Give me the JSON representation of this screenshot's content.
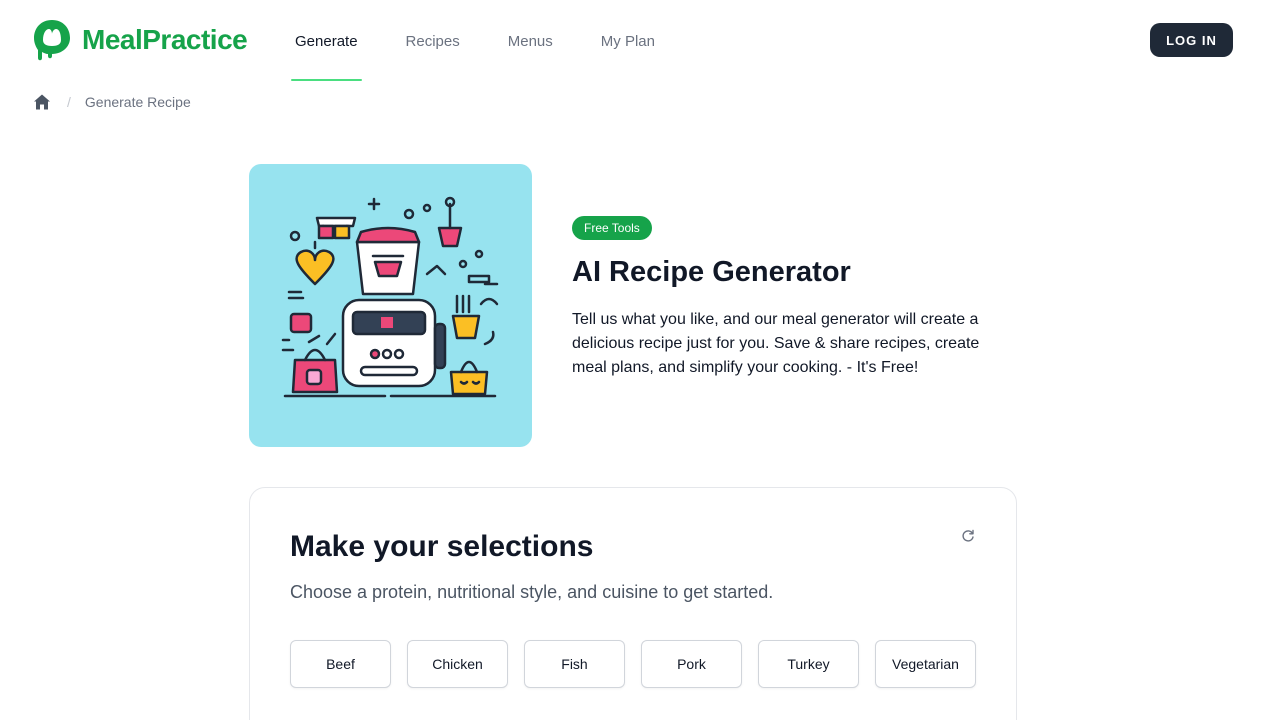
{
  "header": {
    "logo_text": "MealPractice",
    "nav": [
      {
        "label": "Generate",
        "active": true
      },
      {
        "label": "Recipes",
        "active": false
      },
      {
        "label": "Menus",
        "active": false
      },
      {
        "label": "My Plan",
        "active": false
      }
    ],
    "login_label": "LOG IN"
  },
  "breadcrumb": {
    "home_icon": "home-icon",
    "separator": "/",
    "current": "Generate Recipe"
  },
  "hero": {
    "badge": "Free Tools",
    "title": "AI Recipe Generator",
    "description": "Tell us what you like, and our meal generator will create a delicious recipe just for you. Save & share recipes, create meal plans, and simplify your cooking. - It's Free!"
  },
  "selections": {
    "title": "Make your selections",
    "subtitle": "Choose a protein, nutritional style, and cuisine to get started.",
    "refresh_icon": "refresh-icon",
    "proteins": [
      "Beef",
      "Chicken",
      "Fish",
      "Pork",
      "Turkey",
      "Vegetarian"
    ]
  },
  "colors": {
    "brand_green": "#16a34a",
    "nav_underline": "#4ade80",
    "login_bg": "#1f2937",
    "hero_bg": "#97e3ef"
  }
}
